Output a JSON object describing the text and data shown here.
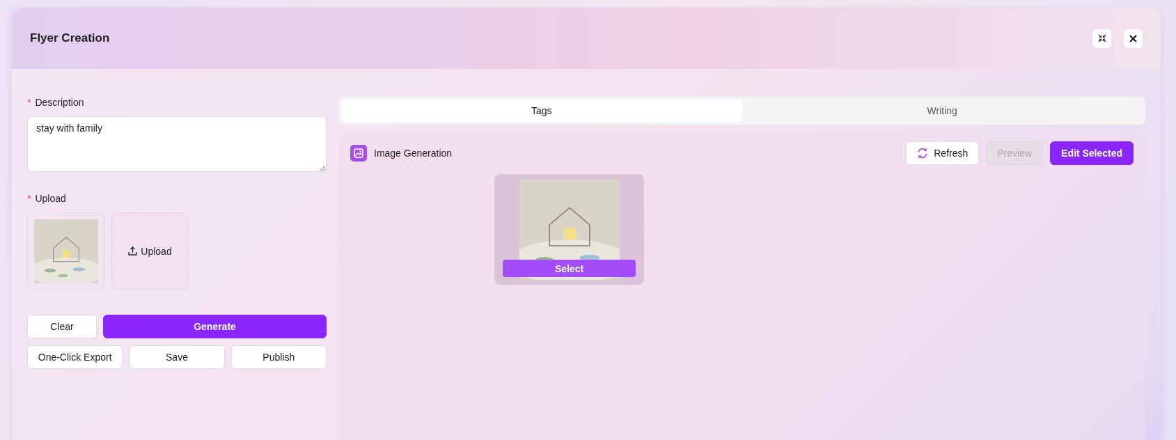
{
  "window": {
    "title": "Flyer Creation",
    "controls": [
      {
        "kind": "collapse"
      },
      {
        "kind": "close"
      }
    ]
  },
  "form": {
    "description": {
      "label": "Description",
      "required_mark": "*",
      "value": "stay with family"
    },
    "upload": {
      "label": "Upload",
      "required_mark": "*",
      "button": "Upload"
    }
  },
  "actions": [
    [
      {
        "label": "Clear",
        "kind": "default"
      },
      {
        "label": "Generate",
        "kind": "primary"
      }
    ],
    [
      {
        "label": "One-Click Export",
        "kind": "default"
      },
      {
        "label": "Save",
        "kind": "default"
      },
      {
        "label": "Publish",
        "kind": "default"
      }
    ]
  ],
  "tabs": [
    {
      "label": "Tags",
      "selected": true
    },
    {
      "label": "Writing",
      "selected": false
    }
  ],
  "panel": {
    "title": "Image Generation",
    "buttons": [
      {
        "label": "Refresh",
        "kind": "refresh",
        "disabled": false
      },
      {
        "label": "Preview",
        "kind": "default",
        "disabled": true
      },
      {
        "label": "Edit Selected",
        "kind": "primary",
        "disabled": false
      }
    ],
    "results": [
      {
        "button": "Select"
      }
    ]
  }
}
